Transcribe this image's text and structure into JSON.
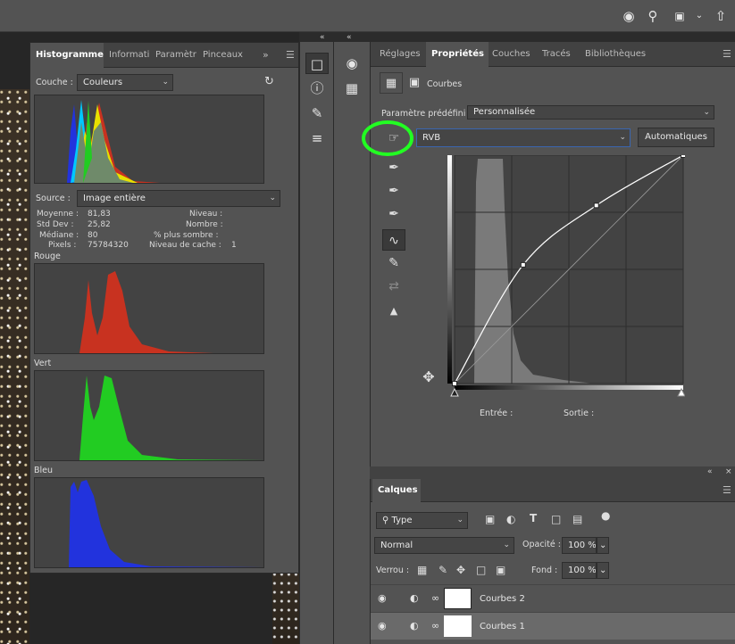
{
  "colors": {
    "panel": "#535353",
    "accent_highlight": "#22ff22",
    "hist_red": "#c83220",
    "hist_green": "#22cc22",
    "hist_blue": "#2233dd"
  },
  "topbar": {
    "icons": [
      "user-share-icon",
      "search-icon",
      "workspace-icon",
      "chevron-down-icon",
      "share-icon"
    ]
  },
  "histogram": {
    "tabs": [
      "Histogramme",
      "Informati",
      "Paramètr",
      "Pinceaux"
    ],
    "channel_label": "Couche :",
    "channel_value": "Couleurs",
    "source_label": "Source :",
    "source_value": "Image entière",
    "stats": {
      "mean_label": "Moyenne :",
      "mean": "81,83",
      "std_label": "Std Dev :",
      "std": "25,82",
      "median_label": "Médiane :",
      "median": "80",
      "pixels_label": "Pixels :",
      "pixels": "75784320",
      "level_label": "Niveau :",
      "count_label": "Nombre :",
      "percentile_label": "% plus sombre :",
      "cache_label": "Niveau de cache :",
      "cache": "1"
    },
    "red_label": "Rouge",
    "green_label": "Vert",
    "blue_label": "Bleu"
  },
  "properties": {
    "tabs": [
      "Réglages",
      "Propriétés",
      "Couches",
      "Tracés",
      "Bibliothèques"
    ],
    "header_label": "Courbes",
    "preset_label": "Paramètre prédéfini :",
    "preset_value": "Personnalisée",
    "channel_value": "RVB",
    "auto_button": "Automatiques",
    "input_label": "Entrée :",
    "output_label": "Sortie :",
    "curve_points": [
      [
        0,
        0
      ],
      [
        0.3,
        0.52
      ],
      [
        0.62,
        0.78
      ],
      [
        1,
        1
      ]
    ]
  },
  "layers": {
    "tab": "Calques",
    "filter_value": "Type",
    "blend_mode": "Normal",
    "opacity_label": "Opacité :",
    "opacity_value": "100 %",
    "lock_label": "Verrou :",
    "fill_label": "Fond :",
    "fill_value": "100 %",
    "items": [
      {
        "name": "Courbes 2"
      },
      {
        "name": "Courbes 1"
      }
    ]
  }
}
